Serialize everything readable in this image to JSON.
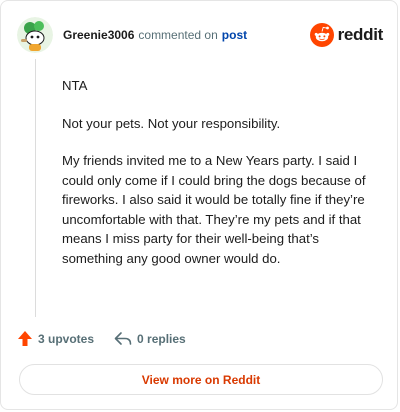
{
  "header": {
    "username": "Greenie3006",
    "action_text": "commented on",
    "post_link": "post",
    "brand_name": "reddit"
  },
  "comment": {
    "paragraphs": [
      "NTA",
      "Not your pets. Not your responsibility.",
      "My friends invited me to a New Years party. I said I could only come if I could bring the dogs because of fireworks. I also said it would be totally fine if they’re uncomfortable with that. They’re my pets and if that means I miss party for their well-being that’s something any good owner would do."
    ]
  },
  "actions": {
    "upvotes": "3 upvotes",
    "replies": "0 replies"
  },
  "view_more_label": "View more on Reddit",
  "colors": {
    "brand": "#ff4500",
    "link": "#0045ac",
    "view_more": "#d93900",
    "muted": "#576f76"
  }
}
